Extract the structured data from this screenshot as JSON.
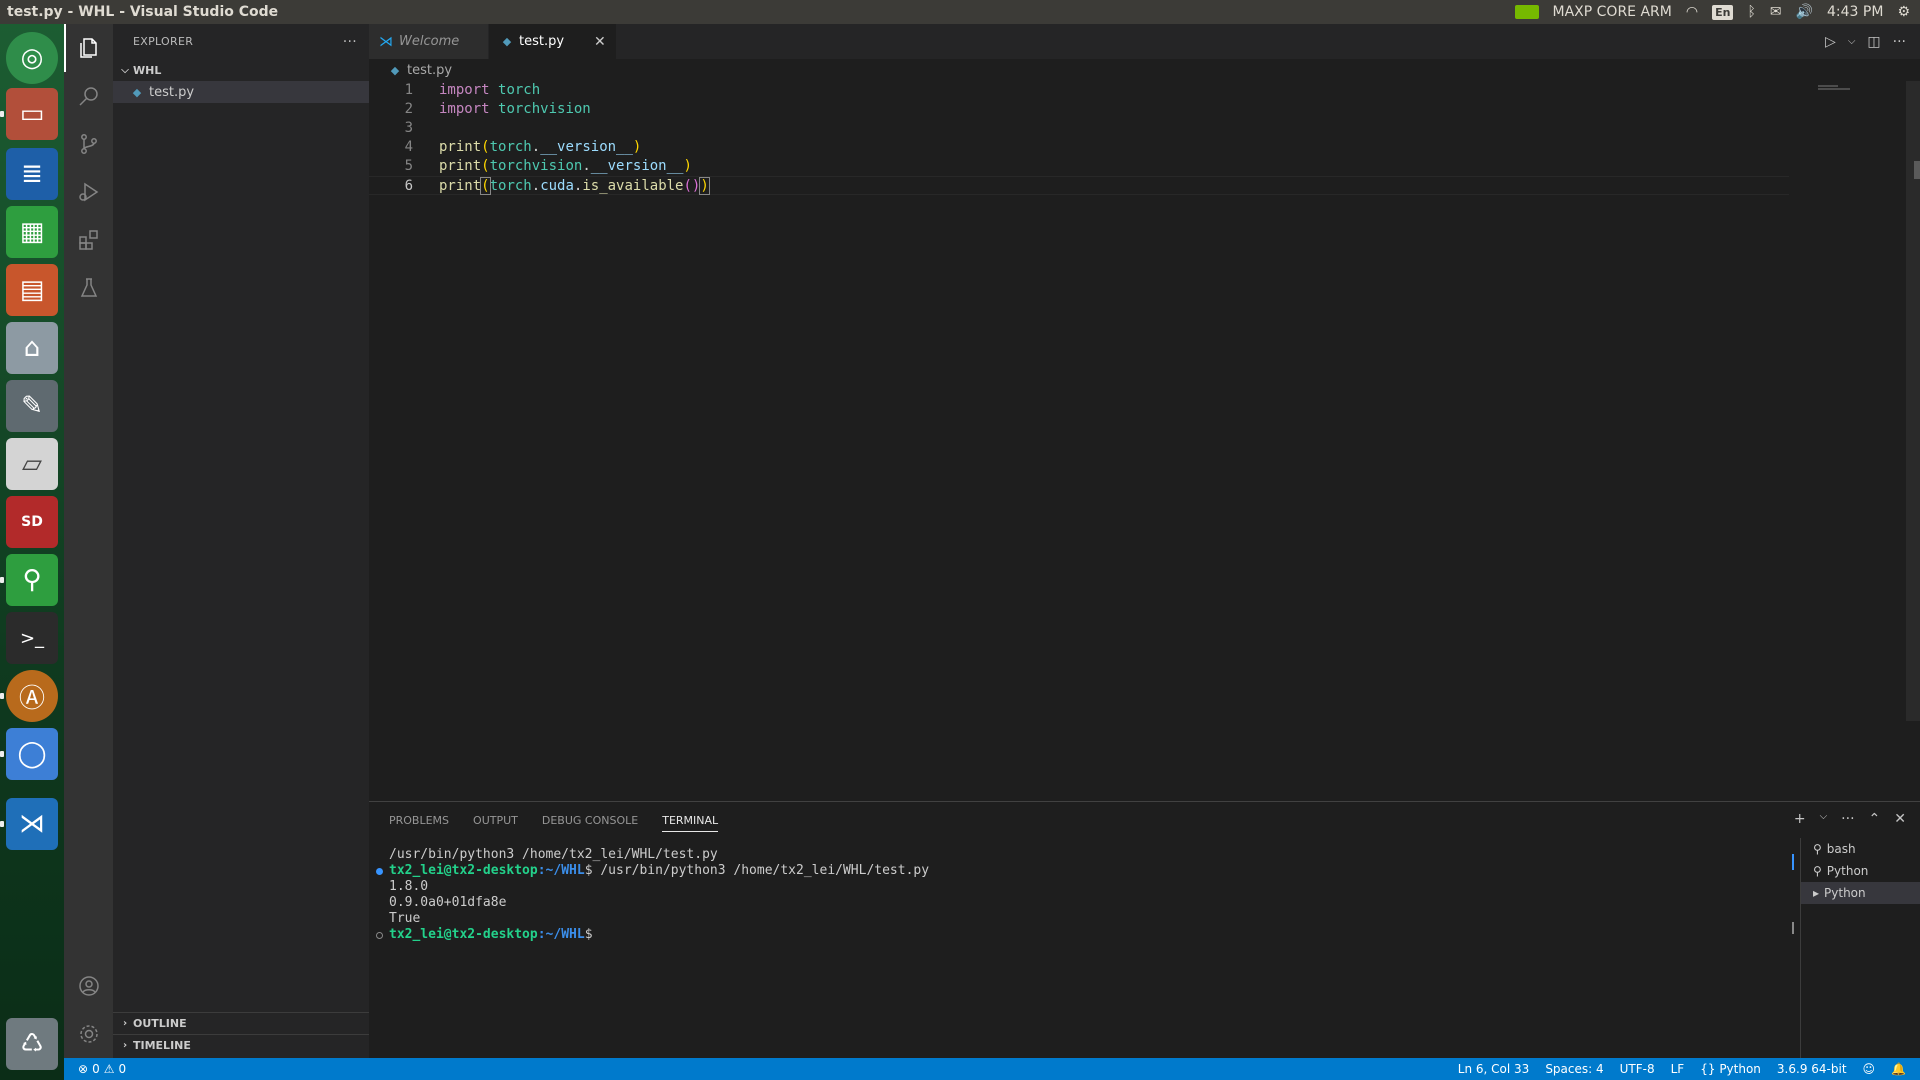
{
  "topbar": {
    "window_title": "test.py - WHL - Visual Studio Code",
    "power_mode": "MAXP CORE ARM",
    "keyboard": "En",
    "time": "4:43 PM"
  },
  "launcher": {
    "items": [
      "ubuntu-dash-icon",
      "files-icon",
      "writer-icon",
      "calc-icon",
      "impress-icon",
      "software-center-icon",
      "system-settings-icon",
      "drive-icon",
      "sd-card-icon",
      "usb-drive-icon",
      "terminal-icon",
      "software-updater-icon",
      "chromium-icon",
      "vscode-icon",
      "trash-icon"
    ]
  },
  "sidebar": {
    "header": "EXPLORER",
    "folder": "WHL",
    "file": "test.py",
    "outline": "OUTLINE",
    "timeline": "TIMELINE"
  },
  "tabs": [
    {
      "label": "Welcome"
    },
    {
      "label": "test.py"
    }
  ],
  "breadcrumb": "test.py",
  "editor": {
    "line_numbers": [
      "1",
      "2",
      "3",
      "4",
      "5",
      "6"
    ]
  },
  "panel": {
    "tabs": [
      "PROBLEMS",
      "OUTPUT",
      "DEBUG CONSOLE",
      "TERMINAL"
    ],
    "terminal": {
      "line1": "/usr/bin/python3 /home/tx2_lei/WHL/test.py",
      "prompt_user": "tx2_lei@tx2-desktop",
      "prompt_path": ":~/WHL",
      "command": "$ /usr/bin/python3 /home/tx2_lei/WHL/test.py",
      "out1": "1.8.0",
      "out2": "0.9.0a0+01dfa8e",
      "out3": "True",
      "prompt_end": "$"
    },
    "terminals": [
      "bash",
      "Python",
      "Python"
    ]
  },
  "statusbar": {
    "errors": "0",
    "warnings": "0",
    "position": "Ln 6, Col 33",
    "spaces": "Spaces: 4",
    "encoding": "UTF-8",
    "eol": "LF",
    "language": "Python",
    "interpreter": "3.6.9 64-bit"
  }
}
